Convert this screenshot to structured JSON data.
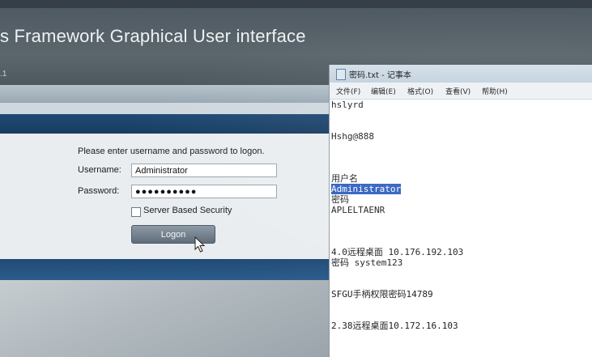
{
  "app": {
    "title": "s Framework Graphical User interface",
    "version": ".1"
  },
  "login": {
    "prompt": "Please enter username and password to logon.",
    "username_label": "Username:",
    "username_value": "Administrator",
    "password_label": "Password:",
    "password_value": "●●●●●●●●●●",
    "security_label": "Server Based Security",
    "security_checked": false,
    "logon_label": "Logon"
  },
  "notepad": {
    "title": "密码.txt - 记事本",
    "menu": [
      "文件(F)",
      "编辑(E)",
      "格式(O)",
      "查看(V)",
      "帮助(H)"
    ],
    "lines": [
      "hslyrd",
      "",
      "",
      "Hshg@888",
      "",
      "",
      "",
      "用户名",
      "Administrator",
      "密码",
      "APLELTAENR",
      "",
      "",
      "",
      "4.0远程桌面 10.176.192.103",
      "密码 system123",
      "",
      "",
      "SFGU手柄权限密码14789",
      "",
      "",
      "2.38远程桌面10.172.16.103"
    ],
    "selected_line": "Administrator"
  },
  "icons": {
    "cursor": "mouse-pointer-icon",
    "file": "notepad-file-icon"
  },
  "colors": {
    "selection": "#2f5fbf",
    "titlebar_blue": "#1f4a75"
  }
}
